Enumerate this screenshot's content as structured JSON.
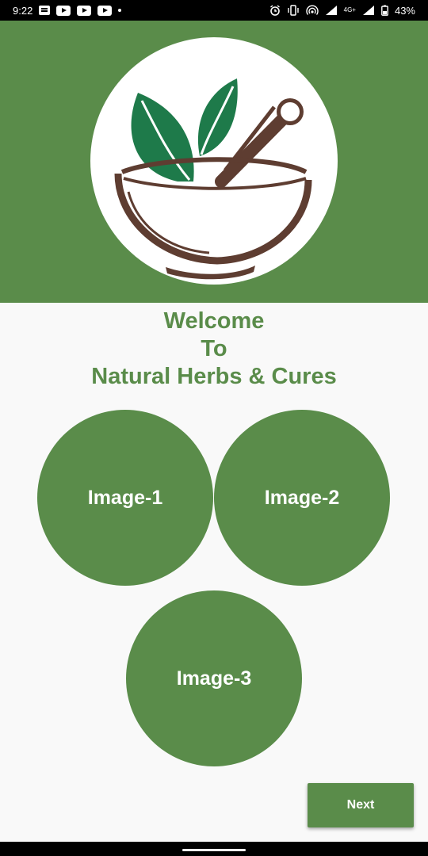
{
  "status_bar": {
    "time": "9:22",
    "network": "4G+",
    "battery": "43%",
    "left_icons": [
      "message-icon",
      "youtube-icon",
      "youtube-icon",
      "youtube-icon",
      "dot-icon"
    ],
    "right_icons": [
      "alarm-icon",
      "vibrate-icon",
      "hotspot-icon",
      "signal-icon",
      "network-4g-icon",
      "signal-icon",
      "battery-icon"
    ]
  },
  "hero": {
    "background_color": "#5a8c4a",
    "logo": "mortar-pestle-leaves-logo"
  },
  "welcome": {
    "line1": "Welcome",
    "line2": "To",
    "line3": "Natural Herbs & Cures",
    "color": "#5a8c4a"
  },
  "images": [
    {
      "label": "Image-1"
    },
    {
      "label": "Image-2"
    },
    {
      "label": "Image-3"
    }
  ],
  "next_button": {
    "label": "Next"
  }
}
